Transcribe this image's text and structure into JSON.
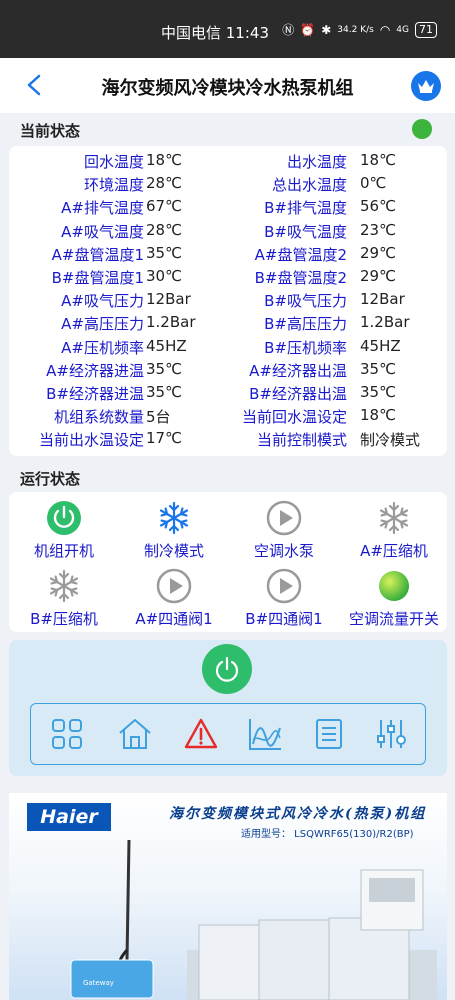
{
  "status_bar": {
    "carrier": "中国电信",
    "time": "11:43",
    "speed": "34.2 K/s",
    "signal": "4G",
    "battery": "71"
  },
  "header": {
    "title": "海尔变频风冷模块冷水热泵机组"
  },
  "current_status": {
    "label": "当前状态",
    "rows": [
      {
        "l_label": "回水温度",
        "l_value": "18℃",
        "r_label": "出水温度",
        "r_value": "18℃"
      },
      {
        "l_label": "环境温度",
        "l_value": "28℃",
        "r_label": "总出水温度",
        "r_value": "0℃"
      },
      {
        "l_label": "A#排气温度",
        "l_value": "67℃",
        "r_label": "B#排气温度",
        "r_value": "56℃"
      },
      {
        "l_label": "A#吸气温度",
        "l_value": "28℃",
        "r_label": "B#吸气温度",
        "r_value": "23℃"
      },
      {
        "l_label": "A#盘管温度1",
        "l_value": "35℃",
        "r_label": "A#盘管温度2",
        "r_value": "29℃"
      },
      {
        "l_label": "B#盘管温度1",
        "l_value": "30℃",
        "r_label": "B#盘管温度2",
        "r_value": "29℃"
      },
      {
        "l_label": "A#吸气压力",
        "l_value": "12Bar",
        "r_label": "B#吸气压力",
        "r_value": "12Bar"
      },
      {
        "l_label": "A#高压压力",
        "l_value": "1.2Bar",
        "r_label": "B#高压压力",
        "r_value": "1.2Bar"
      },
      {
        "l_label": "A#压机频率",
        "l_value": "45HZ",
        "r_label": "B#压机频率",
        "r_value": "45HZ"
      },
      {
        "l_label": "A#经济器进温",
        "l_value": "35℃",
        "r_label": "A#经济器出温",
        "r_value": "35℃"
      },
      {
        "l_label": "B#经济器进温",
        "l_value": "35℃",
        "r_label": "B#经济器出温",
        "r_value": "35℃"
      },
      {
        "l_label": "机组系统数量",
        "l_value": "5台",
        "r_label": "当前回水温设定",
        "r_value": "18℃"
      },
      {
        "l_label": "当前出水温设定",
        "l_value": "17℃",
        "r_label": "当前控制模式",
        "r_value": "制冷模式"
      }
    ]
  },
  "run_status": {
    "label": "运行状态",
    "items": [
      {
        "label": "机组开机",
        "icon": "power-on-icon"
      },
      {
        "label": "制冷模式",
        "icon": "snowflake-icon"
      },
      {
        "label": "空调水泵",
        "icon": "play-icon"
      },
      {
        "label": "A#压缩机",
        "icon": "snowflake-icon"
      },
      {
        "label": "B#压缩机",
        "icon": "snowflake-icon"
      },
      {
        "label": "A#四通阀1",
        "icon": "play-icon"
      },
      {
        "label": "B#四通阀1",
        "icon": "play-icon"
      },
      {
        "label": "空调流量开关",
        "icon": "flow-switch-icon"
      }
    ]
  },
  "nav": {
    "items": [
      "grid-icon",
      "home-icon",
      "alarm-icon",
      "chart-icon",
      "list-icon",
      "settings-icon"
    ]
  },
  "banner": {
    "brand": "Haier",
    "title": "海尔变频模块式风冷冷水(热泵)机组",
    "model": "适用型号： LSQWRF65(130)/R2(BP)",
    "gateway_label": "Gateway"
  },
  "colors": {
    "label_blue": "#1a1acc",
    "accent_blue": "#1976e8",
    "status_green": "#3cb43c",
    "power_green": "#2ebd6b",
    "alarm_red": "#e52b2b"
  }
}
